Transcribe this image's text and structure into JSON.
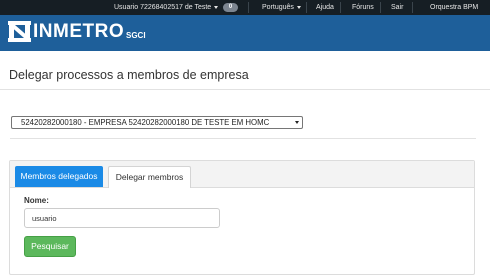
{
  "topbar": {
    "user": "Usuario 72268402517 de Teste",
    "notifications_count": "0",
    "language": "Português",
    "help": "Ajuda",
    "forums": "Fóruns",
    "logout": "Sair",
    "product": "Orquestra BPM"
  },
  "header": {
    "brand": "INMETRO",
    "system": "SGCI",
    "brand_color": "#1e5f9a"
  },
  "page": {
    "title": "Delegar processos a membros de empresa"
  },
  "company_select": {
    "selected": "52420282000180 - EMPRESA 52420282000180 DE TESTE EM HOMC"
  },
  "tabs": [
    {
      "label": "Membros delegados",
      "active": true
    },
    {
      "label": "Delegar membros",
      "active": false
    }
  ],
  "form": {
    "name_label": "Nome:",
    "name_value": "usuario",
    "search_label": "Pesquisar",
    "search_color": "#5cb85c",
    "tab_active_color": "#1a8ae6"
  }
}
